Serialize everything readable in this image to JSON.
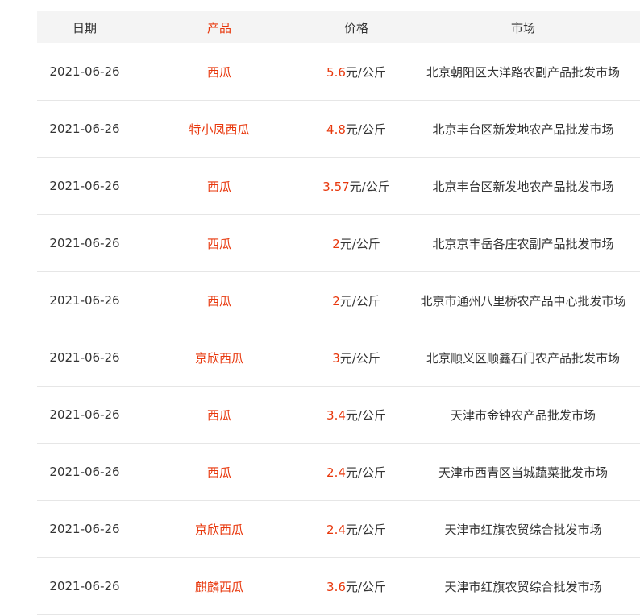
{
  "table": {
    "headers": {
      "date": "日期",
      "product": "产品",
      "price": "价格",
      "market": "市场"
    },
    "rows": [
      {
        "date": "2021-06-26",
        "product": "西瓜",
        "price": "5.6",
        "unit": "元/公斤",
        "market": "北京朝阳区大洋路农副产品批发市场"
      },
      {
        "date": "2021-06-26",
        "product": "特小凤西瓜",
        "price": "4.8",
        "unit": "元/公斤",
        "market": "北京丰台区新发地农产品批发市场"
      },
      {
        "date": "2021-06-26",
        "product": "西瓜",
        "price": "3.57",
        "unit": "元/公斤",
        "market": "北京丰台区新发地农产品批发市场"
      },
      {
        "date": "2021-06-26",
        "product": "西瓜",
        "price": "2",
        "unit": "元/公斤",
        "market": "北京京丰岳各庄农副产品批发市场"
      },
      {
        "date": "2021-06-26",
        "product": "西瓜",
        "price": "2",
        "unit": "元/公斤",
        "market": "北京市通州八里桥农产品中心批发市场"
      },
      {
        "date": "2021-06-26",
        "product": "京欣西瓜",
        "price": "3",
        "unit": "元/公斤",
        "market": "北京顺义区顺鑫石门农产品批发市场"
      },
      {
        "date": "2021-06-26",
        "product": "西瓜",
        "price": "3.4",
        "unit": "元/公斤",
        "market": "天津市金钟农产品批发市场"
      },
      {
        "date": "2021-06-26",
        "product": "西瓜",
        "price": "2.4",
        "unit": "元/公斤",
        "market": "天津市西青区当城蔬菜批发市场"
      },
      {
        "date": "2021-06-26",
        "product": "京欣西瓜",
        "price": "2.4",
        "unit": "元/公斤",
        "market": "天津市红旗农贸综合批发市场"
      },
      {
        "date": "2021-06-26",
        "product": "麒麟西瓜",
        "price": "3.6",
        "unit": "元/公斤",
        "market": "天津市红旗农贸综合批发市场"
      }
    ]
  },
  "colors": {
    "accent": "#e8380d",
    "text": "#333333",
    "header_bg": "#f4f4f4"
  }
}
